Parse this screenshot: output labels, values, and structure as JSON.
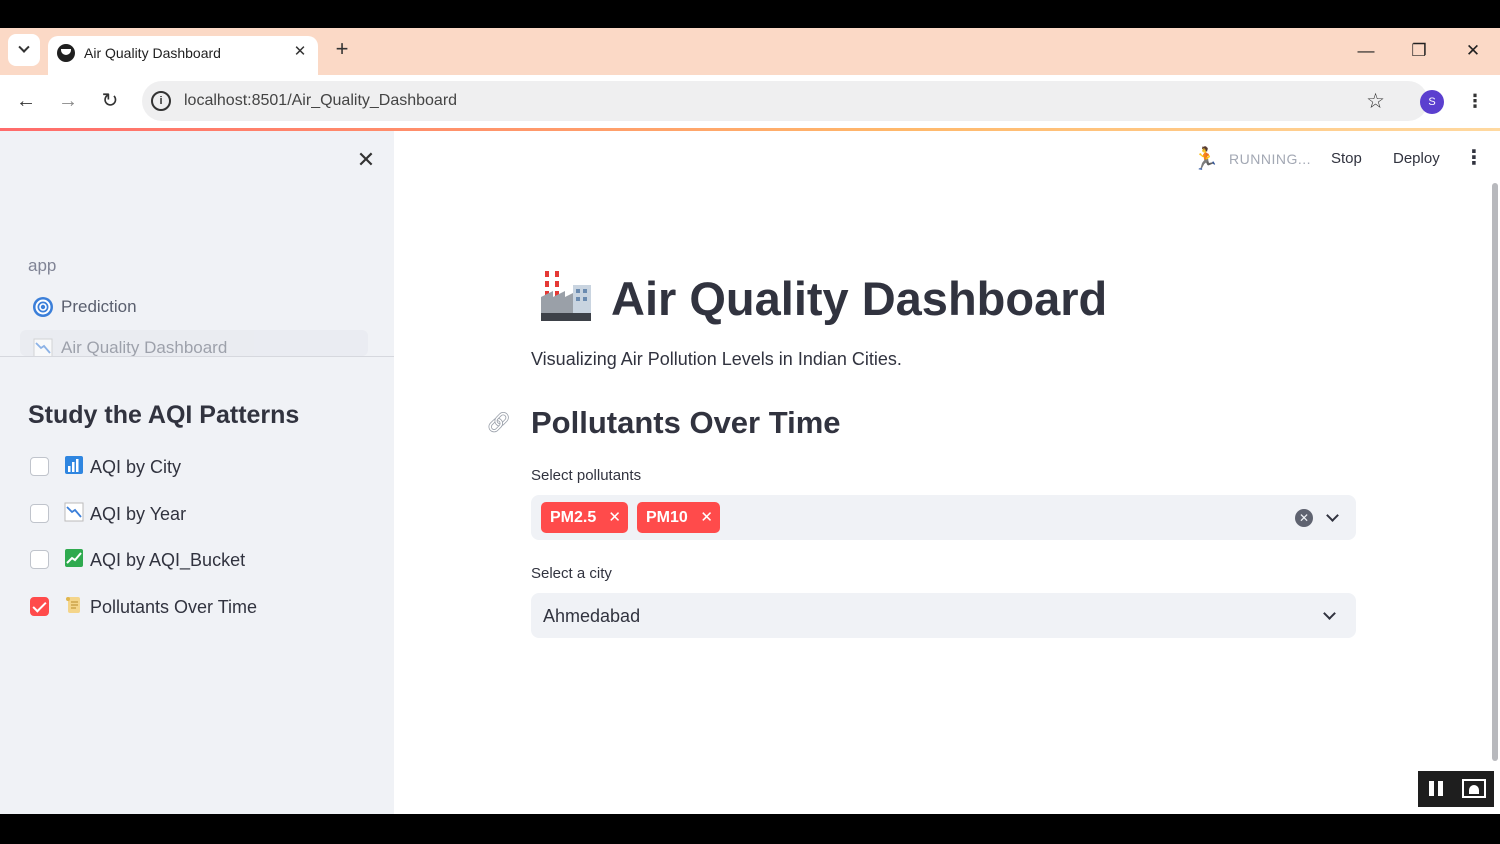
{
  "browser": {
    "tab_title": "Air Quality Dashboard",
    "url": "localhost:8501/Air_Quality_Dashboard",
    "profile_initial": "S"
  },
  "header": {
    "status": "RUNNING...",
    "stop_label": "Stop",
    "deploy_label": "Deploy"
  },
  "sidebar": {
    "nav_section": "app",
    "nav_items": [
      {
        "label": "Prediction",
        "icon": "cyclone-icon"
      },
      {
        "label": "Air Quality Dashboard",
        "icon": "chart-down-icon"
      }
    ],
    "heading": "Study the AQI Patterns",
    "checkboxes": [
      {
        "label": "AQI by City",
        "icon": "bar-chart-icon",
        "checked": false
      },
      {
        "label": "AQI by Year",
        "icon": "chart-down-icon",
        "checked": false
      },
      {
        "label": "AQI by AQI_Bucket",
        "icon": "chart-up-icon",
        "checked": false
      },
      {
        "label": "Pollutants Over Time",
        "icon": "scroll-icon",
        "checked": true
      }
    ]
  },
  "main": {
    "title": "Air Quality Dashboard",
    "subtitle": "Visualizing Air Pollution Levels in Indian Cities.",
    "section_title": "Pollutants Over Time",
    "pollutants_label": "Select pollutants",
    "selected_pollutants": [
      "PM2.5",
      "PM10"
    ],
    "city_label": "Select a city",
    "city_value": "Ahmedabad"
  },
  "colors": {
    "accent": "#ff4b4b",
    "sidebar_bg": "#f0f2f6",
    "text": "#31333f",
    "tabstrip": "#fbd9c6"
  }
}
